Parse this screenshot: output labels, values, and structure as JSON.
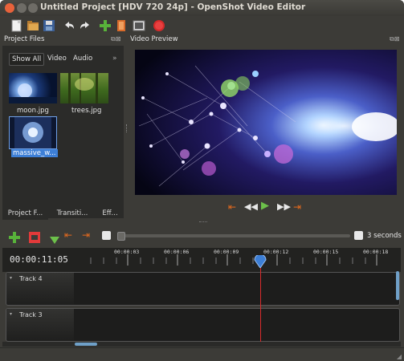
{
  "window": {
    "title": "Untitled Project [HDV 720 24p] - OpenShot Video Editor"
  },
  "toolbar": {
    "icons": [
      "new-project-icon",
      "open-project-icon",
      "save-project-icon",
      "undo-icon",
      "redo-icon",
      "import-files-icon",
      "profile-icon",
      "fullscreen-icon",
      "export-video-icon"
    ]
  },
  "project_files": {
    "header": "Project Files",
    "filters": [
      "Show All",
      "Video",
      "Audio"
    ],
    "items": [
      {
        "name": "moon.jpg"
      },
      {
        "name": "trees.jpg"
      },
      {
        "name": "massive_w..."
      }
    ],
    "selected_index": 2
  },
  "bottom_tabs": [
    "Project F...",
    "Transiti...",
    "Eff..."
  ],
  "video_preview": {
    "header": "Video Preview"
  },
  "timeline": {
    "zoom_label": "3 seconds",
    "timecode": "00:00:11:05",
    "ruler_labels": [
      "00:00:03",
      "00:00:06",
      "00:00:09",
      "00:00:12",
      "00:00:15",
      "00:00:18"
    ],
    "tracks": [
      {
        "name": "Track 4"
      },
      {
        "name": "Track 3"
      }
    ]
  },
  "colors": {
    "accent": "#e36a1e",
    "playhead": "#d92c2c",
    "selection": "#3d7fd6"
  }
}
